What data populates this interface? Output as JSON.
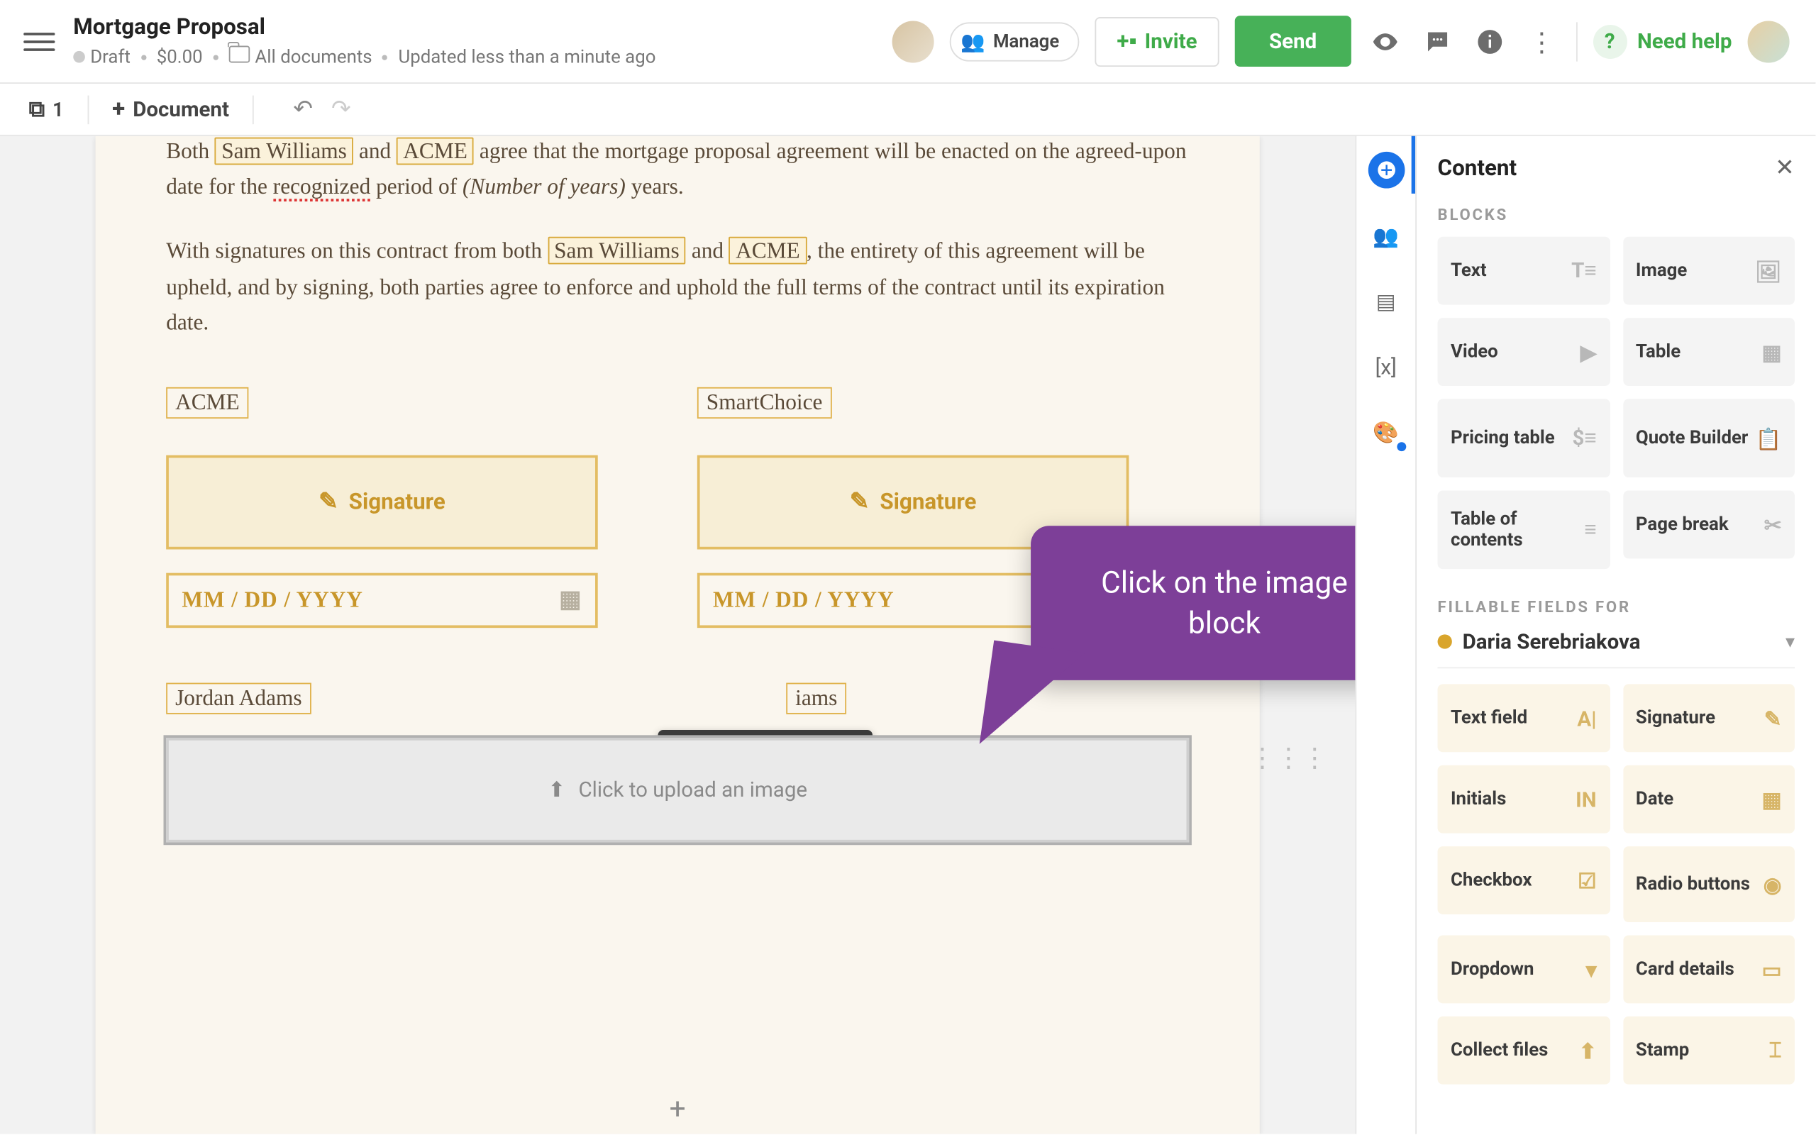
{
  "header": {
    "title": "Mortgage Proposal",
    "status": "Draft",
    "price": "$0.00",
    "folder": "All documents",
    "updated": "Updated less than a minute ago",
    "manage": "Manage",
    "invite": "Invite",
    "send": "Send",
    "help": "Need help"
  },
  "toolbar": {
    "page_count": "1",
    "add_document": "Document"
  },
  "document": {
    "p1a": "Both ",
    "p1_t1": "Sam Williams",
    "p1b": " and ",
    "p1_t2": "ACME",
    "p1c": " agree that the mortgage proposal agreement will be enacted on the agreed-upon date for the ",
    "p1_rec": "recognized",
    "p1d": " period of ",
    "p1_years": "(Number of years)",
    "p1e": " years.",
    "p2a": "With signatures on this contract from both ",
    "p2_t1": "Sam Williams",
    "p2b": " and ",
    "p2_t2": "ACME",
    "p2c": ", the entirety of this agreement will be upheld, and by signing, both parties agree to enforce and uphold the full terms of the contract until its expiration date.",
    "party_left": "ACME",
    "party_right": "SmartChoice",
    "signature_label": "Signature",
    "date_placeholder": "MM / DD / YYYY",
    "name_left": "Jordan Adams",
    "name_right": "iams",
    "upload_label": "Click to upload an image"
  },
  "callout": {
    "text": "Click on the image block"
  },
  "panel": {
    "title": "Content",
    "blocks_label": "BLOCKS",
    "blocks": [
      {
        "label": "Text"
      },
      {
        "label": "Image"
      },
      {
        "label": "Video"
      },
      {
        "label": "Table"
      },
      {
        "label": "Pricing table"
      },
      {
        "label": "Quote Builder"
      },
      {
        "label": "Table of contents"
      },
      {
        "label": "Page break"
      }
    ],
    "fields_label": "FILLABLE FIELDS FOR",
    "assignee": "Daria Serebriakova",
    "fields": [
      {
        "label": "Text field"
      },
      {
        "label": "Signature"
      },
      {
        "label": "Initials"
      },
      {
        "label": "Date"
      },
      {
        "label": "Checkbox"
      },
      {
        "label": "Radio buttons"
      },
      {
        "label": "Dropdown"
      },
      {
        "label": "Card details"
      },
      {
        "label": "Collect files"
      },
      {
        "label": "Stamp"
      }
    ]
  }
}
